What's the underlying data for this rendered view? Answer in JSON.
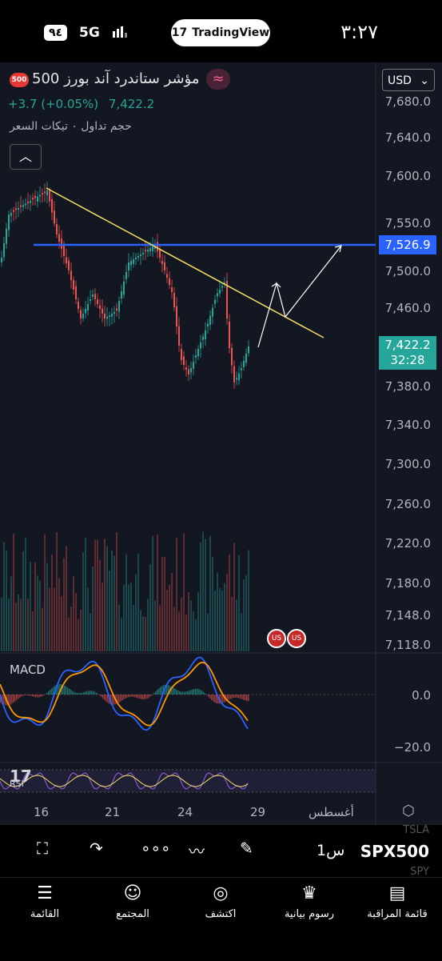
{
  "status_bar": {
    "time": "٣:٢٧",
    "app_pill": "TradingView",
    "network": "5G",
    "battery": "٩٤"
  },
  "header": {
    "title": "مؤشر ستاندرد آند بورز 500",
    "badge": "500",
    "change": "+3.7 (+0.05%)",
    "price": "7,422.2",
    "subinfo": "حجم تداول ٠ تيكات السعر",
    "currency": "USD"
  },
  "price_axis": {
    "ticks": [
      "7,680.0",
      "7,640.0",
      "7,600.0",
      "7,550.0",
      "7,500.0",
      "7,460.0",
      "7,380.0",
      "7,340.0",
      "7,300.0",
      "7,260.0",
      "7,220.0",
      "7,180.0",
      "7,148.0",
      "7,118.0"
    ],
    "level_tag": "7,526.9",
    "current_tag": "7,422.2",
    "countdown": "32:28"
  },
  "macd": {
    "label": "MACD",
    "ticks": [
      "0.0",
      "−20.0"
    ]
  },
  "rsi": {
    "label": "RSI"
  },
  "time_axis": {
    "labels": [
      "16",
      "21",
      "24",
      "29",
      "أغسطس"
    ]
  },
  "toolbar": {
    "symbol": "SPX500",
    "interval": "1س",
    "ghost_symbols": [
      "TSLA",
      "SPY"
    ]
  },
  "bottom_nav": {
    "items": [
      {
        "label": "قائمة المراقبة",
        "icon": "watchlist-icon"
      },
      {
        "label": "رسوم بيانية",
        "icon": "charts-icon"
      },
      {
        "label": "اكتشف",
        "icon": "compass-icon"
      },
      {
        "label": "المجتمع",
        "icon": "community-icon"
      },
      {
        "label": "القائمة",
        "icon": "menu-icon"
      }
    ]
  },
  "colors": {
    "up": "#26a69a",
    "down": "#ef5350",
    "level": "#2962ff",
    "trend": "#f6e05e",
    "background": "#131722"
  }
}
